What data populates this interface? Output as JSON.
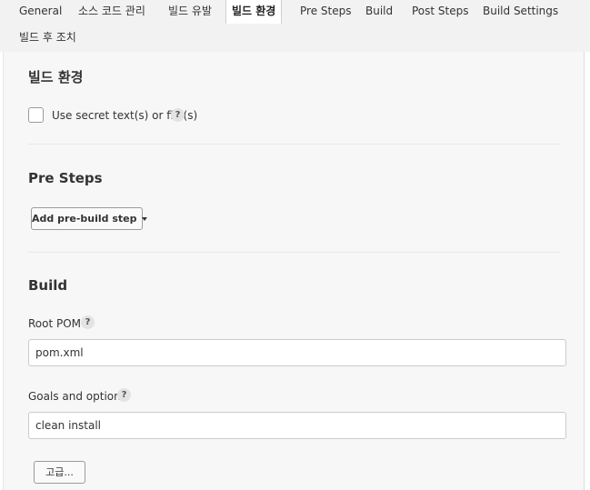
{
  "tabs": {
    "general": "General",
    "scm": "소스 코드 관리",
    "triggers": "빌드 유발",
    "env": "빌드 환경",
    "pre_steps": "Pre Steps",
    "build": "Build",
    "post_steps": "Post Steps",
    "build_settings": "Build Settings",
    "post_build": "빌드 후 조치",
    "active": "빌드 환경"
  },
  "build_env": {
    "title": "빌드 환경",
    "secret_label": "Use secret text(s) or file(s)",
    "secret_checked": false
  },
  "pre_steps": {
    "title": "Pre Steps",
    "add_button": "Add pre-build step"
  },
  "build": {
    "title": "Build",
    "root_pom_label": "Root POM",
    "root_pom_value": "pom.xml",
    "goals_label": "Goals and options",
    "goals_value": "clean install",
    "advanced_button": "고급..."
  },
  "help_glyph": "?",
  "colors": {
    "tabbar_bg": "#f2f2f2",
    "content_bg": "#f7f7f7",
    "active_tab_bg": "#ffffff"
  }
}
